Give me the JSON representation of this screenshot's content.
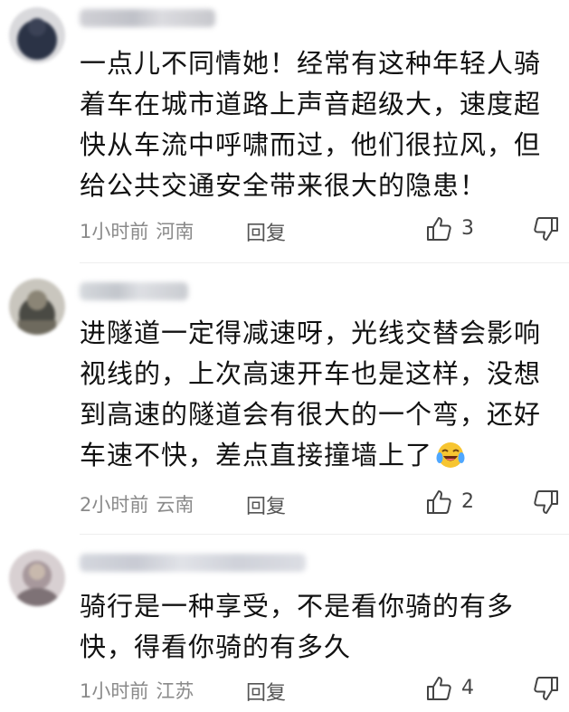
{
  "comments": [
    {
      "lines": [
        "一点儿不同情她！经常有这种年轻人骑",
        "着车在城市道路上声音超级大，速度超",
        "快从车流中呼啸而过，他们很拉风，但",
        "给公共交通安全带来很大的隐患！"
      ],
      "time": "1小时前",
      "location": "河南",
      "reply_label": "回复",
      "likes": "3",
      "avatar_color": "#2b3346",
      "username_color": "#bfbfc6"
    },
    {
      "lines": [
        "进隧道一定得减速呀，光线交替会影响",
        "视线的，上次高速开车也是这样，没想",
        "到高速的隧道会有很大的一个弯，还好",
        "车速不快，差点直接撞墙上了"
      ],
      "has_emoji": true,
      "emoji": "crying-laughing-emoji",
      "time": "2小时前",
      "location": "云南",
      "reply_label": "回复",
      "likes": "2",
      "avatar_color": "#6e6a5e",
      "username_color": "#c4c7cc"
    },
    {
      "lines": [
        "骑行是一种享受，不是看你骑的有多",
        "快，得看你骑的有多久"
      ],
      "time": "1小时前",
      "location": "江苏",
      "reply_label": "回复",
      "likes": "4",
      "avatar_color": "#9a8f93",
      "username_color": "#cfd2da"
    }
  ]
}
